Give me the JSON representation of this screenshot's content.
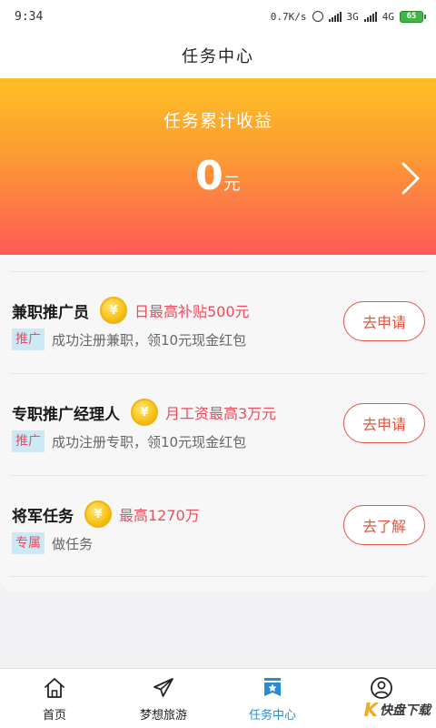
{
  "status_bar": {
    "time": "9:34",
    "speed": "0.7K/s",
    "net1": "3G",
    "net2": "4G",
    "battery": "65"
  },
  "header": {
    "title": "任务中心"
  },
  "earnings": {
    "label": "任务累计收益",
    "amount": "0",
    "unit": "元"
  },
  "coin_symbol": "¥",
  "tasks": [
    {
      "title": "兼职推广员",
      "reward": "日最高补贴500元",
      "tag": "推广",
      "description": "成功注册兼职，领10元现金红包",
      "button": "去申请"
    },
    {
      "title": "专职推广经理人",
      "reward": "月工资最高3万元",
      "tag": "推广",
      "description": "成功注册专职，领10元现金红包",
      "button": "去申请"
    },
    {
      "title": "将军任务",
      "reward": "最高1270万",
      "tag": "专属",
      "description": "做任务",
      "button": "去了解"
    }
  ],
  "nav": [
    {
      "label": "首页",
      "icon": "home-icon"
    },
    {
      "label": "梦想旅游",
      "icon": "paper-plane-icon"
    },
    {
      "label": "任务中心",
      "icon": "star-badge-icon",
      "active": true
    },
    {
      "label": "",
      "icon": "user-icon"
    }
  ],
  "watermark": {
    "k": "K",
    "text": "快盘下载"
  },
  "colors": {
    "accent_red": "#f04a5c",
    "button_orange": "#e5543e",
    "tag_bg": "#cce8f5",
    "active_blue": "#2a8bd0",
    "hero_top": "#fdc024",
    "hero_bottom": "#fe5a57"
  }
}
